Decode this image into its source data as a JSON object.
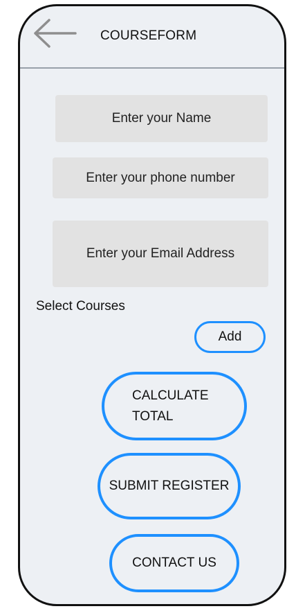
{
  "header": {
    "back_icon": "arrow-left-icon",
    "title": "COURSEFORM"
  },
  "form": {
    "name_placeholder": "Enter your Name",
    "phone_placeholder": "Enter your phone number",
    "email_placeholder": "Enter your Email Address",
    "select_courses_label": "Select Courses",
    "add_label": "Add"
  },
  "actions": {
    "calculate_label": "CALCULATE TOTAL",
    "submit_label": "SUBMIT REGISTER",
    "contact_label": "CONTACT US"
  },
  "colors": {
    "background": "#edf0f4",
    "frame": "#111111",
    "input_fill": "#e2e2e2",
    "button_border": "#1e90ff",
    "divider": "#98a0a9"
  }
}
